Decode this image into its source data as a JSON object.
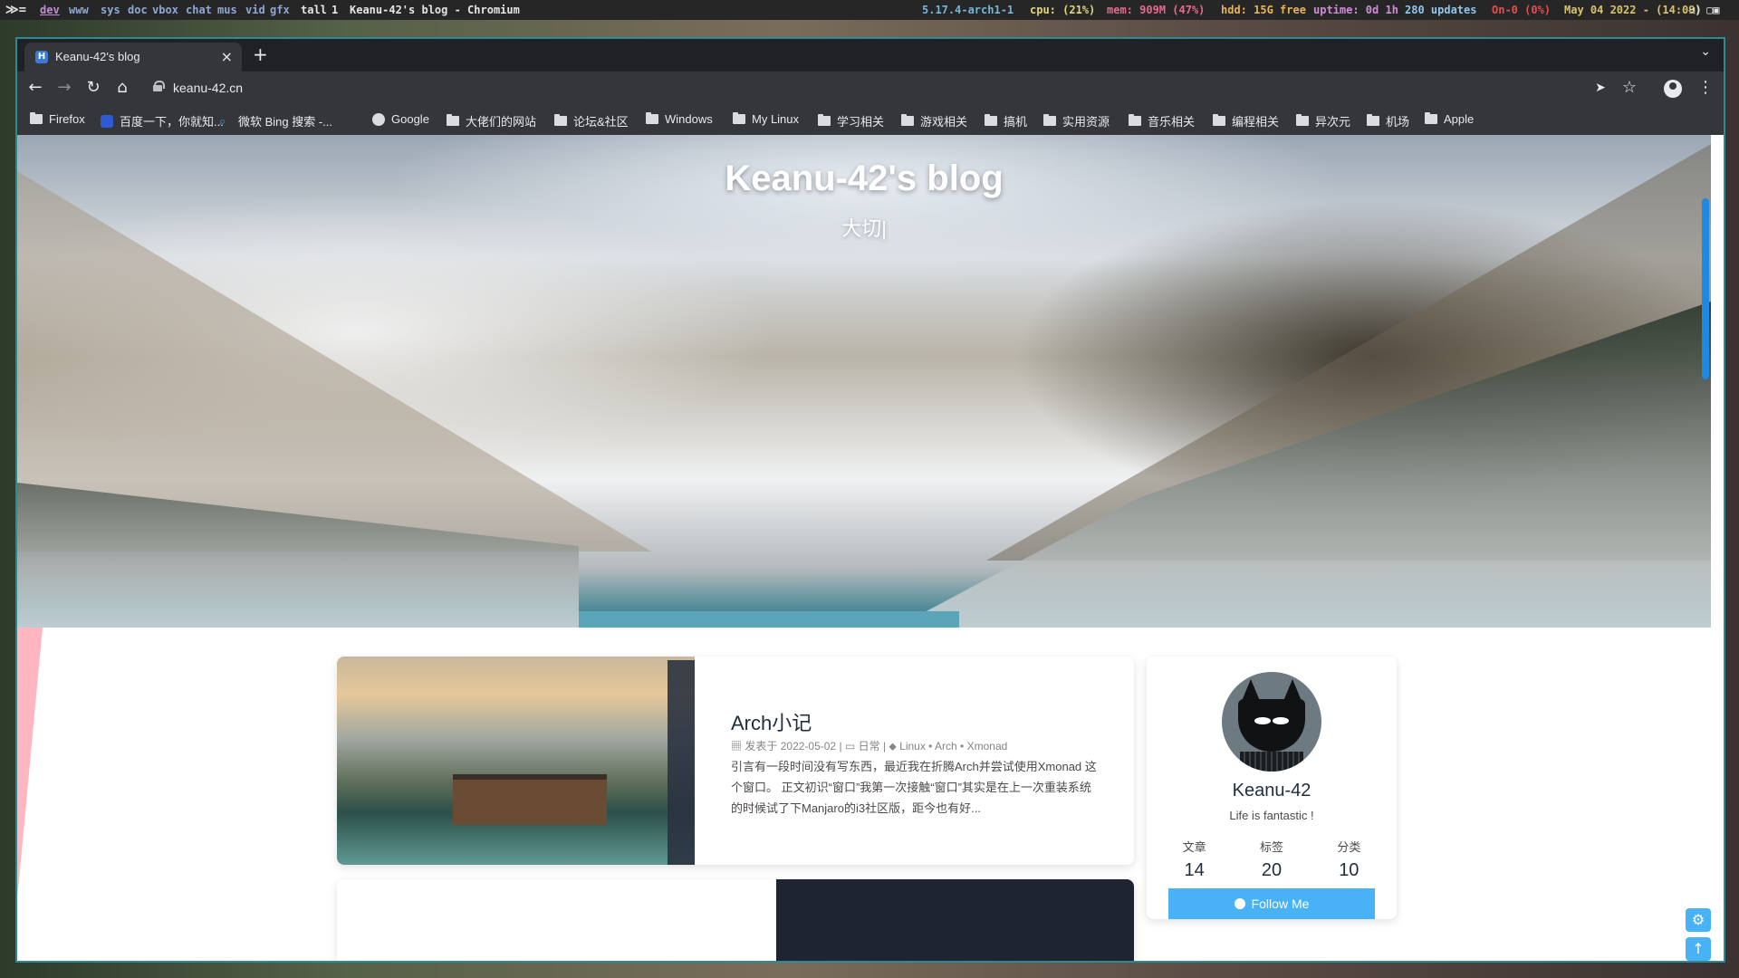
{
  "topbar": {
    "workspaces": [
      "dev",
      "www",
      "sys",
      "doc",
      "vbox",
      "chat",
      "mus",
      "vid",
      "gfx"
    ],
    "active_workspace": "dev",
    "layout": "tall",
    "window_count": "1",
    "window_title": "Keanu-42's blog - Chromium",
    "kernel": "5.17.4-arch1-1",
    "cpu": "cpu: (21%)",
    "mem": "mem: 909M (47%)",
    "hdd": "hdd: 15G free",
    "uptime": "uptime: 0d 1h",
    "updates": "280 updates",
    "net": "On-0 (0%)",
    "datetime": "May 04 2022 - (14:09)",
    "colors": {
      "kernel": "#74b7d8",
      "cpu": "#e2d576",
      "mem": "#e46b8f",
      "hdd": "#e8b35a",
      "uptime": "#d18cd8",
      "updates": "#8fc7ea",
      "net": "#e05050",
      "datetime": "#d9c36a"
    }
  },
  "browser": {
    "tab": {
      "title": "Keanu-42's blog",
      "favicon": "H"
    },
    "url": "keanu-42.cn",
    "bookmarks": [
      {
        "label": "Firefox",
        "icon": "folder"
      },
      {
        "label": "百度一下，你就知...",
        "icon": "baidu"
      },
      {
        "label": "微软 Bing 搜索 -...",
        "icon": "bing"
      },
      {
        "label": "Google",
        "icon": "globe"
      },
      {
        "label": "大佬们的网站",
        "icon": "folder"
      },
      {
        "label": "论坛&社区",
        "icon": "folder"
      },
      {
        "label": "Windows",
        "icon": "folder"
      },
      {
        "label": "My Linux",
        "icon": "folder"
      },
      {
        "label": "学习相关",
        "icon": "folder"
      },
      {
        "label": "游戏相关",
        "icon": "folder"
      },
      {
        "label": "搞机",
        "icon": "folder"
      },
      {
        "label": "实用资源",
        "icon": "folder"
      },
      {
        "label": "音乐相关",
        "icon": "folder"
      },
      {
        "label": "编程相关",
        "icon": "folder"
      },
      {
        "label": "异次元",
        "icon": "folder"
      },
      {
        "label": "机场",
        "icon": "folder"
      },
      {
        "label": "Apple",
        "icon": "folder"
      }
    ]
  },
  "site": {
    "title": "Keanu-42's blog",
    "subtitle": "大切|"
  },
  "post": {
    "title": "Arch小记",
    "date_prefix": "发表于",
    "date": "2022-05-02",
    "category": "日常",
    "tags": "Linux • Arch • Xmonad",
    "excerpt": "引言有一段时间没有写东西，最近我在折腾Arch并尝试使用Xmonad 这个窗口。 正文初识“窗口”我第一次接触“窗口”其实是在上一次重装系统的时候试了下Manjaro的i3社区版，距今也有好..."
  },
  "profile": {
    "name": "Keanu-42",
    "motto": "Life is fantastic !",
    "stats": [
      {
        "label": "文章",
        "value": "14"
      },
      {
        "label": "标签",
        "value": "20"
      },
      {
        "label": "分类",
        "value": "10"
      }
    ],
    "follow_label": "Follow Me"
  },
  "accent": "#49b1f5"
}
